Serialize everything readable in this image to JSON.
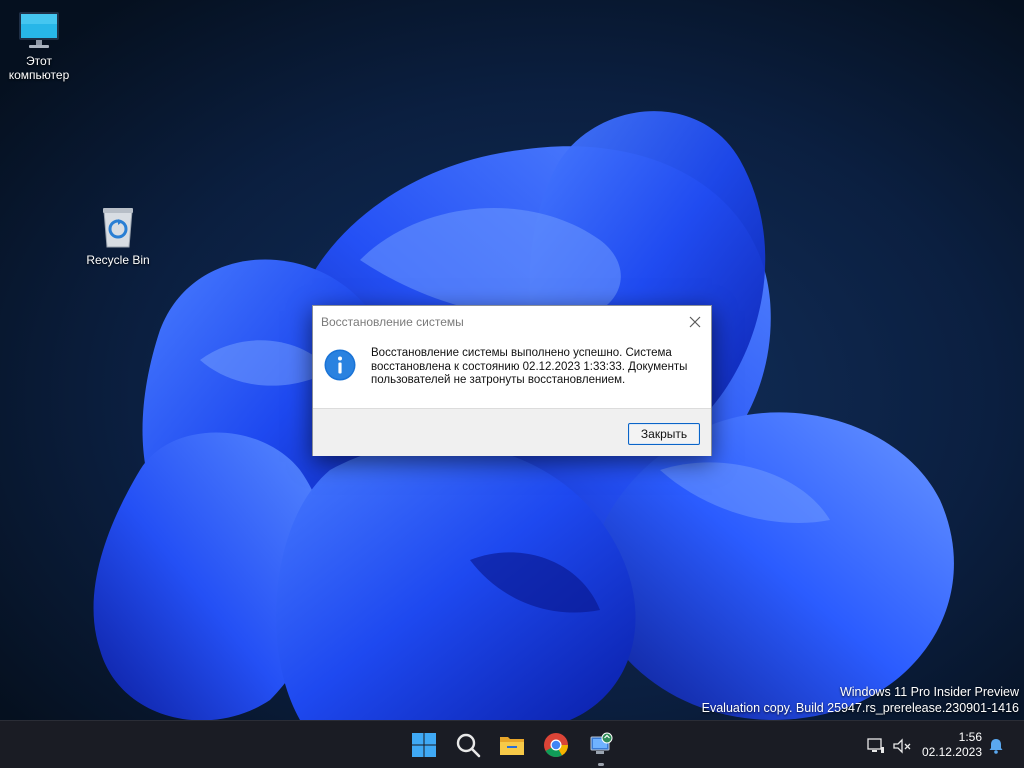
{
  "desktop": {
    "icons": [
      {
        "label": "Этот\nкомпьютер",
        "icon": "monitor-icon"
      },
      {
        "label": "Recycle Bin",
        "icon": "recycle-bin-icon"
      }
    ],
    "watermark": {
      "line1": "Windows 11 Pro Insider Preview",
      "line2": "Evaluation copy. Build 25947.rs_prerelease.230901-1416"
    }
  },
  "dialog": {
    "title": "Восстановление системы",
    "message": "Восстановление системы выполнено успешно. Система восстановлена к состоянию 02.12.2023 1:33:33. Документы пользователей не затронуты восстановлением.",
    "close_button_label": "Закрыть",
    "icon": "info-icon"
  },
  "taskbar": {
    "apps": [
      {
        "name": "Start",
        "icon": "windows-start-icon"
      },
      {
        "name": "Search",
        "icon": "search-icon"
      },
      {
        "name": "File Explorer",
        "icon": "folder-icon"
      },
      {
        "name": "Google Chrome",
        "icon": "chrome-icon"
      },
      {
        "name": "System Restore",
        "icon": "system-restore-icon",
        "active": true
      }
    ],
    "tray": {
      "icons": [
        "network-icon",
        "volume-muted-icon",
        "notification-bell-icon"
      ],
      "time": "1:56",
      "date": "02.12.2023"
    }
  },
  "colors": {
    "wallpaper_bg": "#07152e",
    "bloom_blue": "#1f4fff",
    "dialog_border": "#0a64c8",
    "info_blue": "#1a73d6",
    "taskbar_bg": "#1a1c24"
  }
}
